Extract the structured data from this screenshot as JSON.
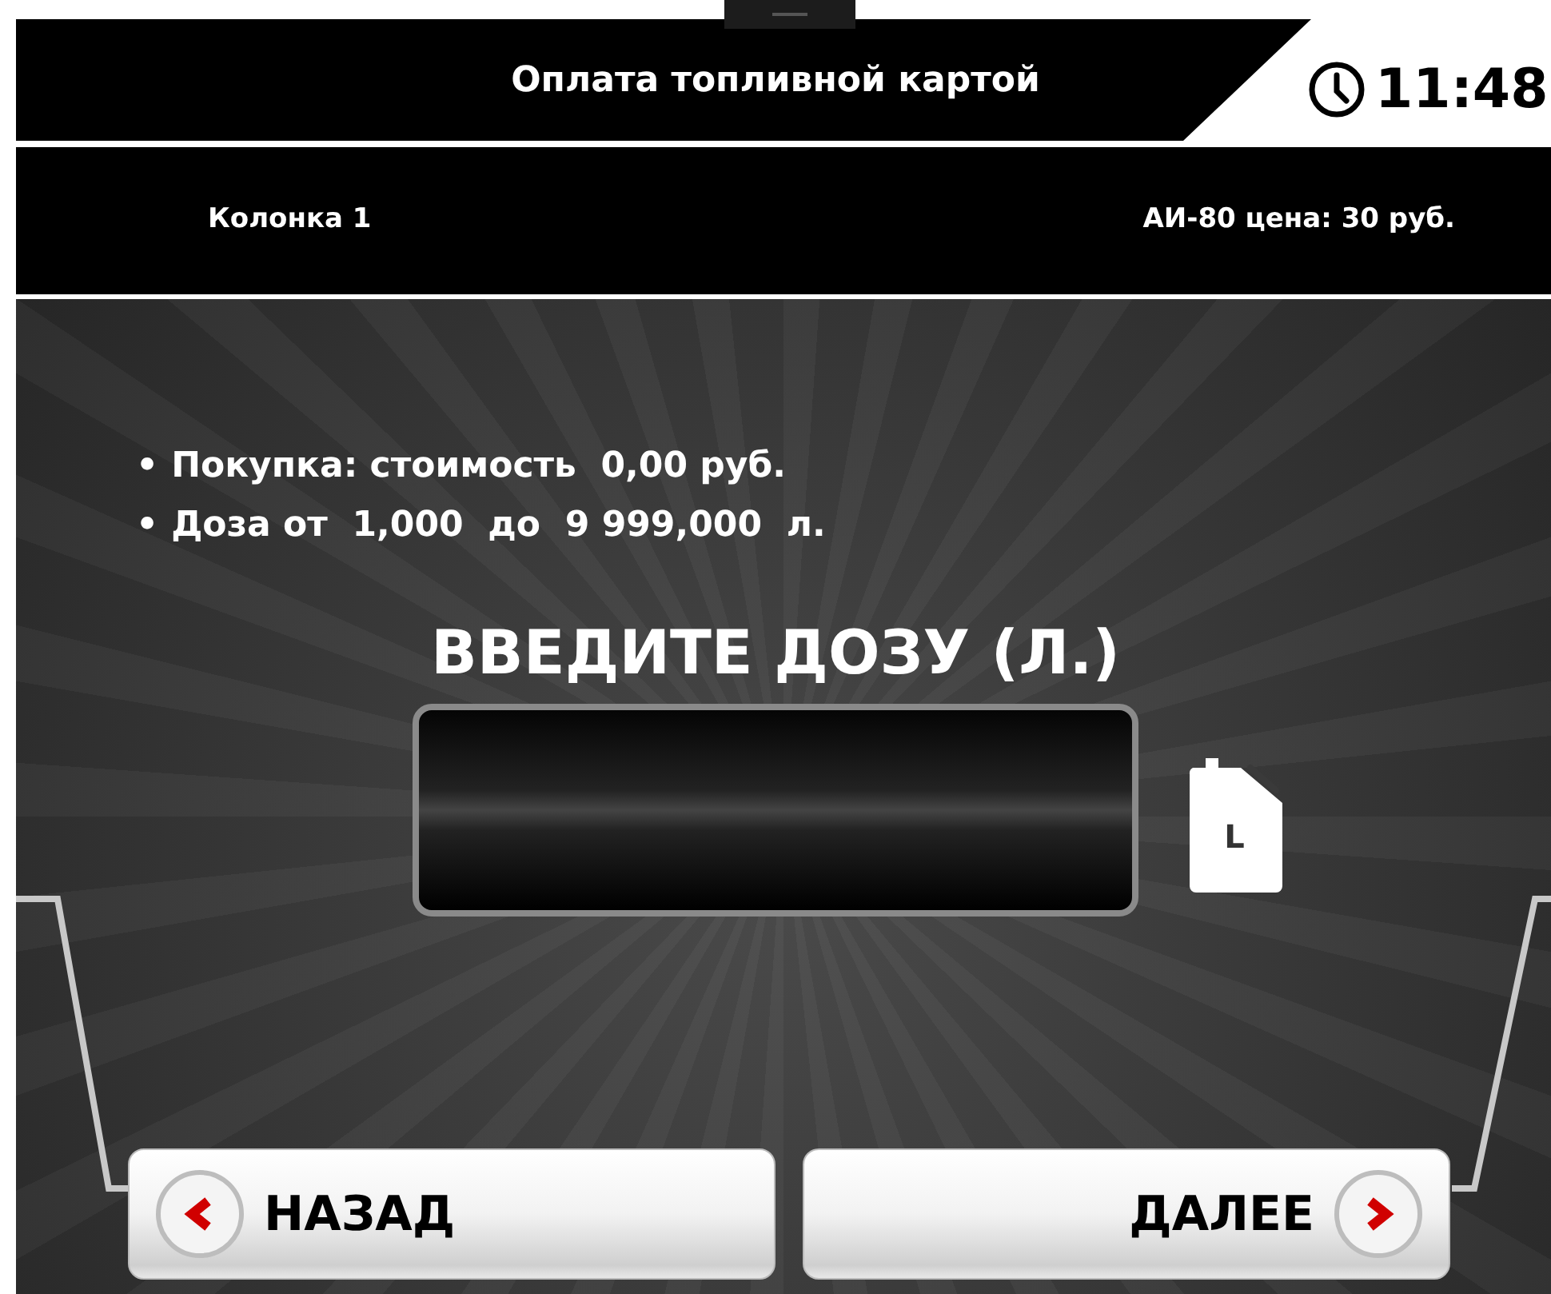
{
  "header": {
    "title": "Оплата топливной картой",
    "time": "11:48"
  },
  "info_bar": {
    "pump": "Колонка 1",
    "fuel_price": "АИ-80 цена: 30 руб."
  },
  "details": [
    {
      "bullet": "•",
      "text": "Покупка: стоимость  0,00 руб."
    },
    {
      "bullet": "•",
      "text": "Доза от  1,000  до  9 999,000  л."
    }
  ],
  "prompt": "ВВЕДИТЕ ДОЗУ (Л.)",
  "canister_label": "L",
  "buttons": [
    {
      "kind": "back",
      "label": "НАЗАД"
    },
    {
      "kind": "next",
      "label": "ДАЛЕЕ"
    }
  ]
}
